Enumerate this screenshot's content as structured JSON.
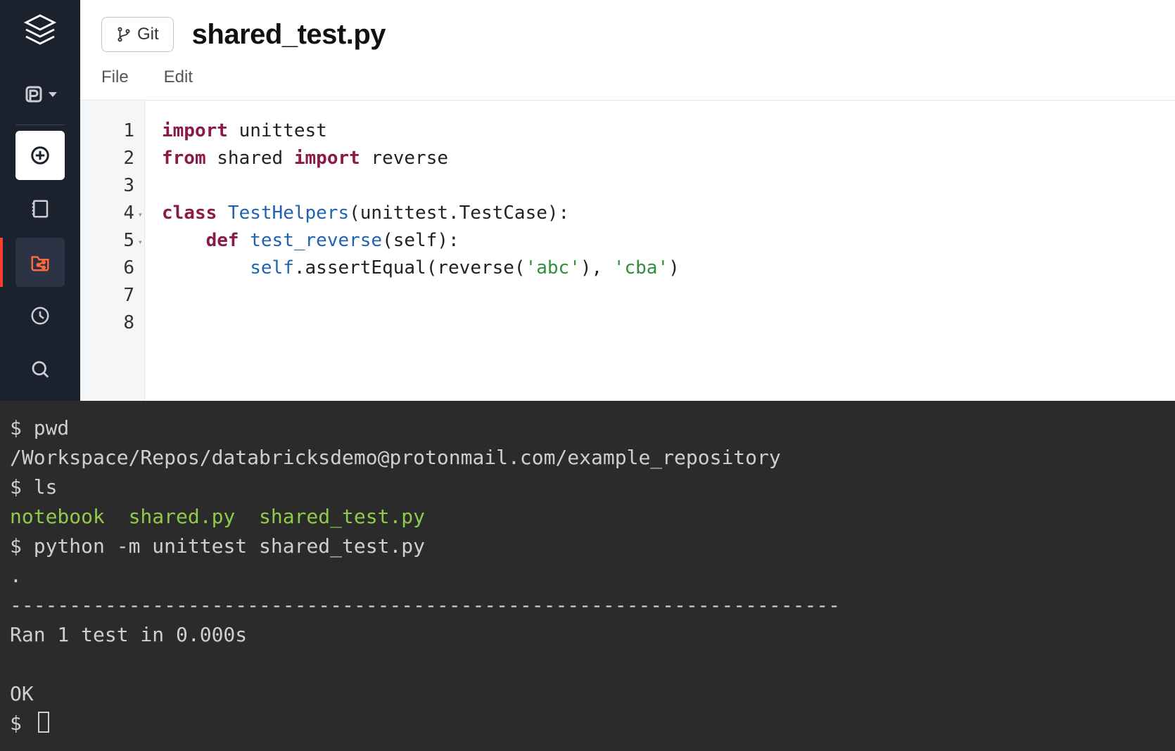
{
  "header": {
    "git_label": "Git",
    "title": "shared_test.py"
  },
  "menubar": {
    "file": "File",
    "edit": "Edit"
  },
  "sidebar": {
    "items": [
      {
        "name": "logo"
      },
      {
        "name": "data"
      },
      {
        "name": "new"
      },
      {
        "name": "notebook"
      },
      {
        "name": "repos"
      },
      {
        "name": "recent"
      },
      {
        "name": "search"
      }
    ]
  },
  "code": {
    "lines": [
      {
        "n": "1",
        "fold": false
      },
      {
        "n": "2",
        "fold": false
      },
      {
        "n": "3",
        "fold": false
      },
      {
        "n": "4",
        "fold": true
      },
      {
        "n": "5",
        "fold": true
      },
      {
        "n": "6",
        "fold": false
      },
      {
        "n": "7",
        "fold": false
      },
      {
        "n": "8",
        "fold": false
      }
    ],
    "tokens": {
      "l1_kw": "import",
      "l1_rest": " unittest",
      "l2_kw1": "from",
      "l2_mid": " shared ",
      "l2_kw2": "import",
      "l2_rest": " reverse",
      "l4_kw": "class",
      "l4_name": " TestHelpers",
      "l4_rest": "(unittest.TestCase):",
      "l5_indent": "    ",
      "l5_kw": "def",
      "l5_name": " test_reverse",
      "l5_rest": "(self):",
      "l6_indent": "        ",
      "l6_self": "self",
      "l6_mid": ".assertEqual(reverse(",
      "l6_str1": "'abc'",
      "l6_mid2": "), ",
      "l6_str2": "'cba'",
      "l6_end": ")"
    }
  },
  "terminal": {
    "prompt": "$ ",
    "cmd_pwd": "pwd",
    "pwd_out": "/Workspace/Repos/databricksdemo@protonmail.com/example_repository",
    "cmd_ls": "ls",
    "ls_out": "notebook  shared.py  shared_test.py",
    "cmd_test": "python -m unittest shared_test.py",
    "dot": ".",
    "sep": "----------------------------------------------------------------------",
    "ran": "Ran 1 test in 0.000s",
    "ok": "OK"
  }
}
